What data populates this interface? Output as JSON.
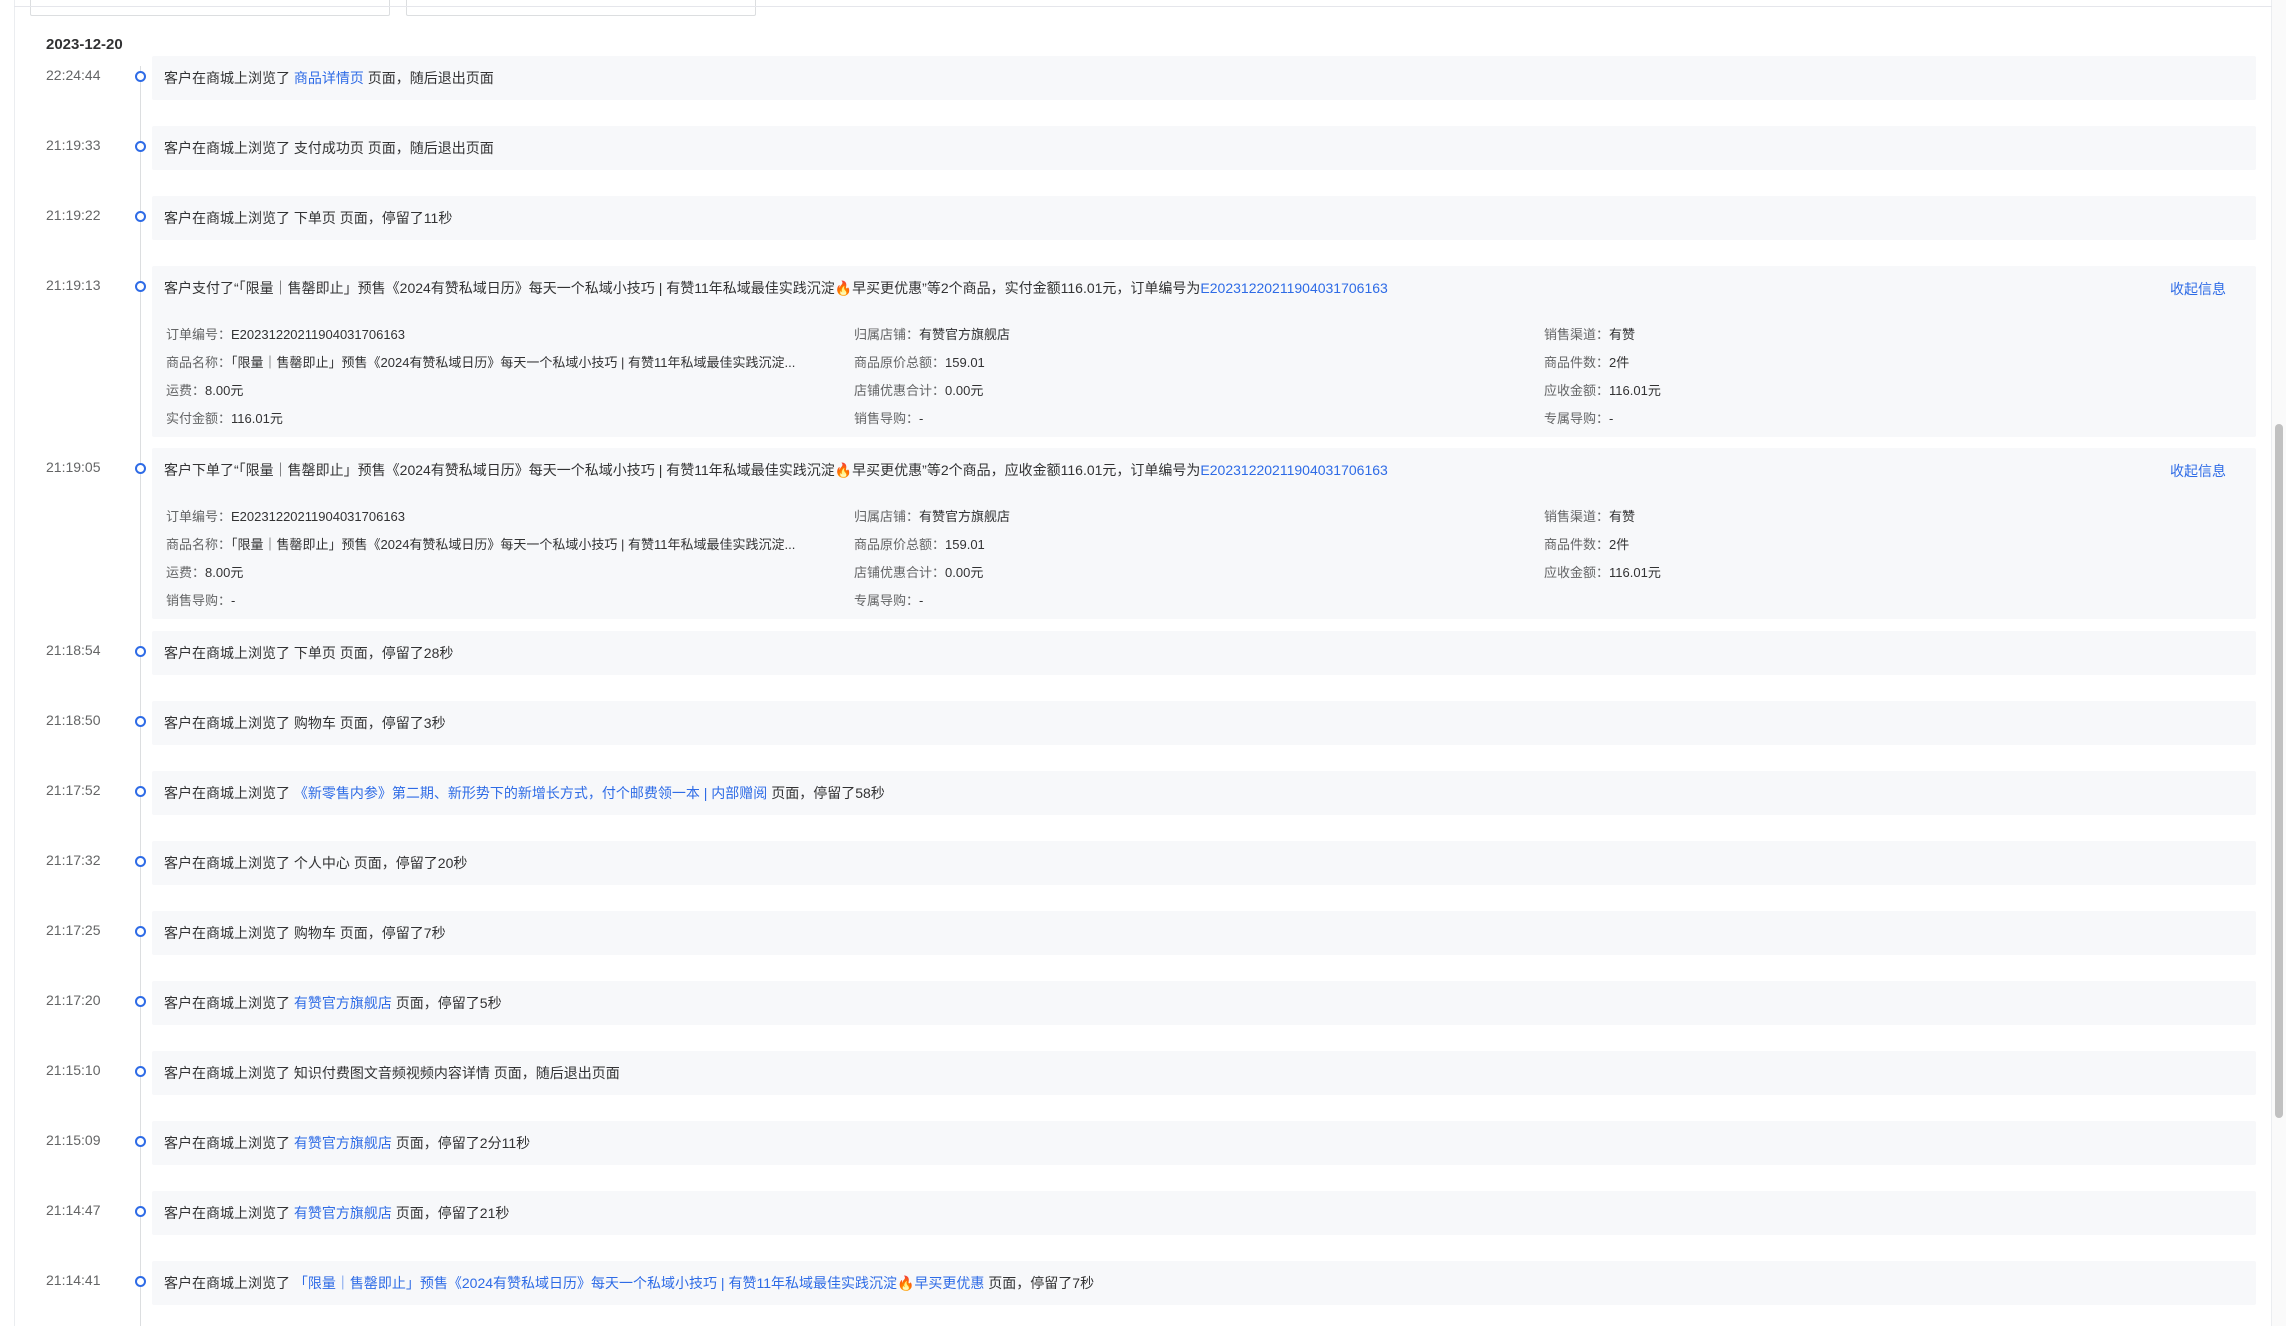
{
  "date": "2023-12-20",
  "events": [
    {
      "time": "22:24:44",
      "prefix": "客户在商城上浏览了 ",
      "target": "商品详情页",
      "suffix": " 页面，随后退出页面",
      "target_is_link": true
    },
    {
      "time": "21:19:33",
      "prefix": "客户在商城上浏览了 ",
      "target": "支付成功页",
      "suffix": " 页面，随后退出页面",
      "target_is_link": false
    },
    {
      "time": "21:19:22",
      "prefix": "客户在商城上浏览了 ",
      "target": "下单页",
      "suffix": " 页面，停留了11秒",
      "target_is_link": false
    },
    {
      "time": "21:19:13",
      "prefix": "客户支付了“「限量｜售罄即止」预售《2024有赞私域日历》每天一个私域小技巧 | 有赞11年私域最佳实践沉淀🔥早买更优惠”等2个商品，实付金额116.01元，订单编号为",
      "target": "E20231220211904031706163",
      "suffix": "",
      "target_is_link": true,
      "collapse_label": "收起信息",
      "details": [
        [
          {
            "label": "订单编号：",
            "value": "E20231220211904031706163"
          },
          {
            "label": "归属店铺：",
            "value": "有赞官方旗舰店"
          },
          {
            "label": "销售渠道：",
            "value": "有赞"
          }
        ],
        [
          {
            "label": "商品名称：",
            "value": "「限量｜售罄即止」预售《2024有赞私域日历》每天一个私域小技巧 | 有赞11年私域最佳实践沉淀..."
          },
          {
            "label": "商品原价总额：",
            "value": "159.01"
          },
          {
            "label": "商品件数：",
            "value": "2件"
          }
        ],
        [
          {
            "label": "运费：",
            "value": "8.00元"
          },
          {
            "label": "店铺优惠合计：",
            "value": "0.00元"
          },
          {
            "label": "应收金额：",
            "value": "116.01元"
          }
        ],
        [
          {
            "label": "实付金额：",
            "value": "116.01元"
          },
          {
            "label": "销售导购：",
            "value": "-"
          },
          {
            "label": "专属导购：",
            "value": "-"
          }
        ]
      ]
    },
    {
      "time": "21:19:05",
      "prefix": "客户下单了“「限量｜售罄即止」预售《2024有赞私域日历》每天一个私域小技巧 | 有赞11年私域最佳实践沉淀🔥早买更优惠”等2个商品，应收金额116.01元，订单编号为",
      "target": "E20231220211904031706163",
      "suffix": "",
      "target_is_link": true,
      "collapse_label": "收起信息",
      "details": [
        [
          {
            "label": "订单编号：",
            "value": "E20231220211904031706163"
          },
          {
            "label": "归属店铺：",
            "value": "有赞官方旗舰店"
          },
          {
            "label": "销售渠道：",
            "value": "有赞"
          }
        ],
        [
          {
            "label": "商品名称：",
            "value": "「限量｜售罄即止」预售《2024有赞私域日历》每天一个私域小技巧 | 有赞11年私域最佳实践沉淀..."
          },
          {
            "label": "商品原价总额：",
            "value": "159.01"
          },
          {
            "label": "商品件数：",
            "value": "2件"
          }
        ],
        [
          {
            "label": "运费：",
            "value": "8.00元"
          },
          {
            "label": "店铺优惠合计：",
            "value": "0.00元"
          },
          {
            "label": "应收金额：",
            "value": "116.01元"
          }
        ],
        [
          {
            "label": "销售导购：",
            "value": "-"
          },
          {
            "label": "专属导购：",
            "value": "-"
          }
        ]
      ]
    },
    {
      "time": "21:18:54",
      "prefix": "客户在商城上浏览了 ",
      "target": "下单页",
      "suffix": " 页面，停留了28秒",
      "target_is_link": false
    },
    {
      "time": "21:18:50",
      "prefix": "客户在商城上浏览了 ",
      "target": "购物车",
      "suffix": " 页面，停留了3秒",
      "target_is_link": false
    },
    {
      "time": "21:17:52",
      "prefix": "客户在商城上浏览了 ",
      "target": "《新零售内参》第二期、新形势下的新增长方式，付个邮费领一本 | 内部赠阅",
      "suffix": " 页面，停留了58秒",
      "target_is_link": true
    },
    {
      "time": "21:17:32",
      "prefix": "客户在商城上浏览了 ",
      "target": "个人中心",
      "suffix": " 页面，停留了20秒",
      "target_is_link": false
    },
    {
      "time": "21:17:25",
      "prefix": "客户在商城上浏览了 ",
      "target": "购物车",
      "suffix": " 页面，停留了7秒",
      "target_is_link": false
    },
    {
      "time": "21:17:20",
      "prefix": "客户在商城上浏览了 ",
      "target": "有赞官方旗舰店",
      "suffix": " 页面，停留了5秒",
      "target_is_link": true
    },
    {
      "time": "21:15:10",
      "prefix": "客户在商城上浏览了 ",
      "target": "知识付费图文音频视频内容详情",
      "suffix": " 页面，随后退出页面",
      "target_is_link": false
    },
    {
      "time": "21:15:09",
      "prefix": "客户在商城上浏览了 ",
      "target": "有赞官方旗舰店",
      "suffix": " 页面，停留了2分11秒",
      "target_is_link": true
    },
    {
      "time": "21:14:47",
      "prefix": "客户在商城上浏览了 ",
      "target": "有赞官方旗舰店",
      "suffix": " 页面，停留了21秒",
      "target_is_link": true
    },
    {
      "time": "21:14:41",
      "prefix": "客户在商城上浏览了 ",
      "target": "「限量｜售罄即止」预售《2024有赞私域日历》每天一个私域小技巧 | 有赞11年私域最佳实践沉淀🔥早买更优惠",
      "suffix": " 页面，停留了7秒",
      "target_is_link": true
    }
  ],
  "colors": {
    "link": "#2e6be6",
    "card_bg": "#f7f8fa",
    "dot": "#2e6be6"
  }
}
